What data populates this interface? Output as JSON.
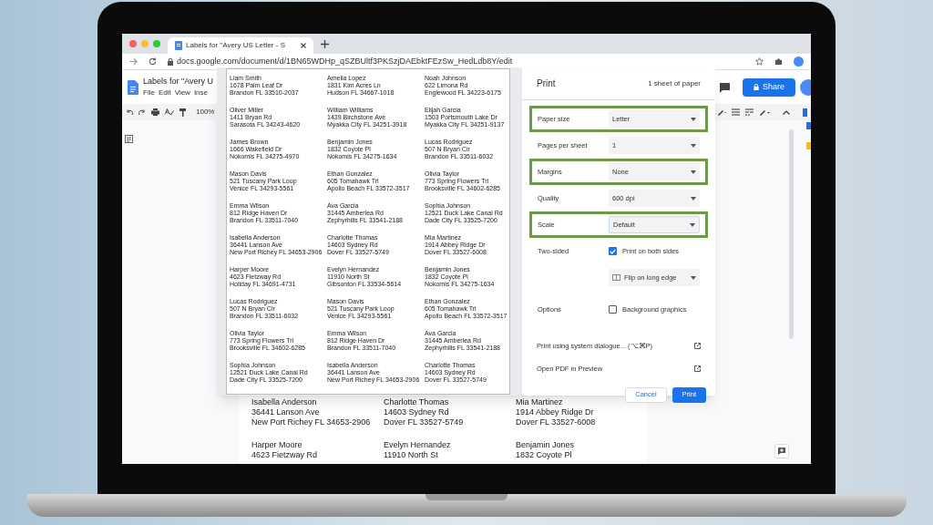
{
  "browser": {
    "tab_title": "Labels for \"Avery US Letter - S",
    "url": "docs.google.com/document/d/1BN65WDHp_qSZBUltf3PKSzjDAEbktFEzSw_HedLdb8Y/edit"
  },
  "docs": {
    "title": "Labels for \"Avery U",
    "menus": [
      "File",
      "Edit",
      "View",
      "Inse"
    ],
    "share": "Share",
    "zoom": "100%"
  },
  "document_labels": [
    {
      "lines": [
        "Isabella Anderson",
        "36441 Lanson Ave",
        "New Port Richey FL 34653-2906"
      ]
    },
    {
      "lines": [
        "Charlotte Thomas",
        "14603 Sydney Rd",
        "Dover FL 33527-5749"
      ]
    },
    {
      "lines": [
        "Mia Martinez",
        "1914 Abbey Ridge Dr",
        "Dover FL 33527-6008"
      ]
    },
    {
      "lines": [
        "Harper Moore",
        "4623 Fietzway Rd"
      ]
    },
    {
      "lines": [
        "Evelyn Hernandez",
        "11910 North St"
      ]
    },
    {
      "lines": [
        "Benjamin Jones",
        "1832 Coyote Pl"
      ]
    }
  ],
  "print_dialog": {
    "title": "Print",
    "sheets": "1 sheet of paper",
    "preview_labels": [
      {
        "lines": [
          "Liam Smith",
          "1678 Palm Leaf Dr",
          "Brandon FL 33510-2037"
        ]
      },
      {
        "lines": [
          "Amelia Lopez",
          "1831 Kim Acres Ln",
          "Hudson FL 34667-1018"
        ]
      },
      {
        "lines": [
          "Noah Johnson",
          "622 Limona Rd",
          "Englewood FL 34223-6175"
        ]
      },
      {
        "lines": [
          "Oliver Miller",
          "1411 Bryan Rd",
          "Sarasota FL 34243-4620"
        ]
      },
      {
        "lines": [
          "William Williams",
          "1439 Birchstone Ave",
          "Myakka City FL 34251-3918"
        ]
      },
      {
        "lines": [
          "Elijah Garcia",
          "1503 Portsmouth Lake Dr",
          "Myakka City FL 34251-9137"
        ]
      },
      {
        "lines": [
          "James Brown",
          "1666 Wakefield Dr",
          "Nokomis FL 34275-4970"
        ]
      },
      {
        "lines": [
          "Benjamin Jones",
          "1832 Coyote Pl",
          "Nokomis FL 34275-1634"
        ]
      },
      {
        "lines": [
          "Lucas Rodriguez",
          "507 N Bryan Cir",
          "Brandon FL 33511-6032"
        ]
      },
      {
        "lines": [
          "Mason Davis",
          "521 Tuscany Park Loop",
          "Venice FL 34293-5561"
        ]
      },
      {
        "lines": [
          "Ethan Gonzalez",
          "605 Tomahawk Trl",
          "Apollo Beach FL 33572-3517"
        ]
      },
      {
        "lines": [
          "Olivia Taylor",
          "773 Spring Flowers Trl",
          "Brooksville FL 34602-6285"
        ]
      },
      {
        "lines": [
          "Emma Wilson",
          "812 Ridge Haven Dr",
          "Brandon FL 33511-7040"
        ]
      },
      {
        "lines": [
          "Ava Garcia",
          "31445 Amberlea Rd",
          "Zephyrhills FL 33541-2188"
        ]
      },
      {
        "lines": [
          "Sophia Johnson",
          "12521 Duck Lake Canal Rd",
          "Dade City FL 33525-7200"
        ]
      },
      {
        "lines": [
          "Isabella Anderson",
          "36441 Lanson Ave",
          "New Port Richey FL 34653-2906"
        ]
      },
      {
        "lines": [
          "Charlotte Thomas",
          "14603 Sydney Rd",
          "Dover FL 33527-5749"
        ]
      },
      {
        "lines": [
          "Mia Martinez",
          "1914 Abbey Ridge Dr",
          "Dover FL 33527-6008"
        ]
      },
      {
        "lines": [
          "Harper Moore",
          "4623 Fietzway Rd",
          "Holiday FL 34691-4731"
        ]
      },
      {
        "lines": [
          "Evelyn Hernandez",
          "11910 North St",
          "Gibsonton FL 33534-5614"
        ]
      },
      {
        "lines": [
          "Benjamin Jones",
          "1832 Coyote Pl",
          "Nokomis FL 34275-1634"
        ]
      },
      {
        "lines": [
          "Lucas Rodriguez",
          "507 N Bryan Cir",
          "Brandon FL 33511-6032"
        ]
      },
      {
        "lines": [
          "Mason Davis",
          "521 Tuscany Park Loop",
          "Venice FL 34293-5561"
        ]
      },
      {
        "lines": [
          "Ethan Gonzalez",
          "605 Tomahawk Trl",
          "Apollo Beach FL 33572-3517"
        ]
      },
      {
        "lines": [
          "Olivia Taylor",
          "773 Spring Flowers Trl",
          "Brooksville FL 34602-6285"
        ]
      },
      {
        "lines": [
          "Emma Wilson",
          "812 Ridge Haven Dr",
          "Brandon FL 33511-7040"
        ]
      },
      {
        "lines": [
          "Ava Garcia",
          "31445 Amberlea Rd",
          "Zephyrhills FL 33541-2188"
        ]
      },
      {
        "lines": [
          "Sophia Johnson",
          "12521 Duck Lake Canal Rd",
          "Dade City FL 33525-7200"
        ]
      },
      {
        "lines": [
          "Isabella Anderson",
          "36441 Lanson Ave",
          "New Port Richey FL 34653-2906"
        ]
      },
      {
        "lines": [
          "Charlotte Thomas",
          "14603 Sydney Rd",
          "Dover FL 33527-5749"
        ]
      }
    ],
    "settings": [
      {
        "kind": "select",
        "label": "Paper size",
        "value": "Letter",
        "highlighted": true
      },
      {
        "kind": "select",
        "label": "Pages per sheet",
        "value": "1",
        "highlighted": false
      },
      {
        "kind": "select",
        "label": "Margins",
        "value": "None",
        "highlighted": true
      },
      {
        "kind": "select",
        "label": "Quality",
        "value": "600 dpi",
        "highlighted": false
      },
      {
        "kind": "select",
        "label": "Scale",
        "value": "Default",
        "highlighted": true
      },
      {
        "kind": "checkbox",
        "label": "Two-sided",
        "value": "Print on both sides",
        "checked": true
      },
      {
        "kind": "flip",
        "value": "Flip on long edge"
      },
      {
        "kind": "checkbox",
        "label": "Options",
        "value": "Background graphics",
        "checked": false
      }
    ],
    "links": [
      "Print using system dialogue... (⌥⌘P)",
      "Open PDF in Preview"
    ],
    "cancel": "Cancel",
    "print": "Print"
  }
}
